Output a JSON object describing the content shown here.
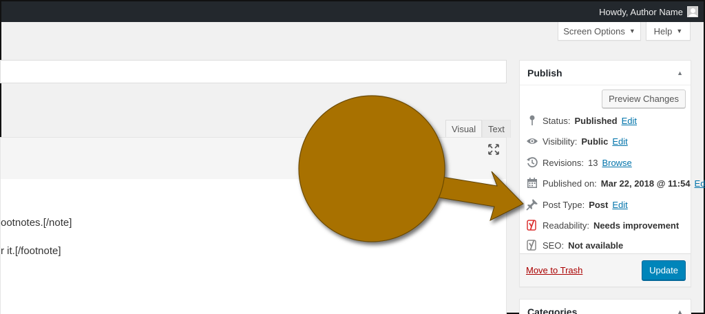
{
  "adminbar": {
    "howdy": "Howdy, Author Name"
  },
  "screen_meta": {
    "screen_options": "Screen Options",
    "help": "Help"
  },
  "editor": {
    "tabs": {
      "visual": "Visual",
      "text": "Text"
    },
    "lines": [
      "ootnotes.[/note]",
      "r it.[/footnote]"
    ]
  },
  "publish": {
    "title": "Publish",
    "preview_label": "Preview Changes",
    "status": {
      "label": "Status:",
      "value": "Published",
      "edit": "Edit"
    },
    "visibility": {
      "label": "Visibility:",
      "value": "Public",
      "edit": "Edit"
    },
    "revisions": {
      "label": "Revisions:",
      "value": "13",
      "link": "Browse"
    },
    "published_on": {
      "label": "Published on:",
      "value": "Mar 22, 2018 @ 11:54",
      "edit": "Edit"
    },
    "post_type": {
      "label": "Post Type:",
      "value": "Post",
      "edit": "Edit"
    },
    "readability": {
      "label": "Readability:",
      "value": "Needs improvement"
    },
    "seo": {
      "label": "SEO:",
      "value": "Not available"
    },
    "trash_label": "Move to Trash",
    "update_label": "Update"
  },
  "categories": {
    "title": "Categories"
  },
  "colors": {
    "admin_bar": "#23282d",
    "primary_button": "#0085ba",
    "link": "#0073aa",
    "trash": "#a00",
    "annotation": "#a87100",
    "readability_red": "#dc3232"
  },
  "icons": [
    "user-avatar-icon",
    "pin-icon",
    "eye-icon",
    "revisions-icon",
    "calendar-icon",
    "thumbtack-icon",
    "yoast-icon",
    "fullscreen-icon",
    "collapse-icon"
  ]
}
